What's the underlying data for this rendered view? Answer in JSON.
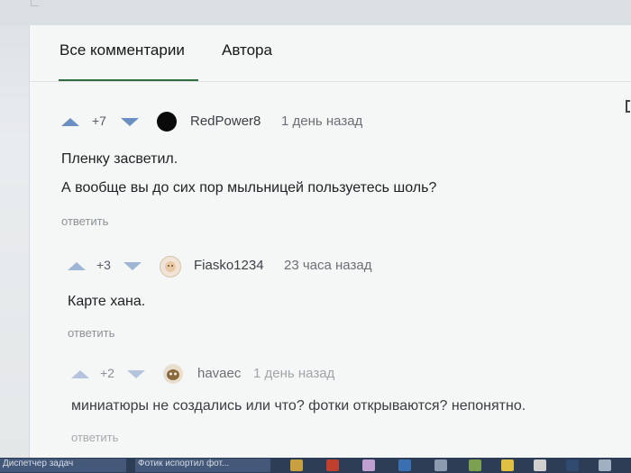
{
  "tabs": {
    "all_comments": "Все комментарии",
    "author": "Автора"
  },
  "comments": [
    {
      "rating": "+7",
      "username": "RedPower8",
      "time": "1 день назад",
      "lines": [
        "Пленку засветил.",
        "А вообще вы до сих пор мыльницей пользуетесь шоль?"
      ],
      "reply_label": "ответить",
      "avatar_icon": "black-circle-avatar"
    },
    {
      "rating": "+3",
      "username": "Fiasko1234",
      "time": "23 часа назад",
      "lines": [
        "Карте хана."
      ],
      "reply_label": "ответить",
      "avatar_icon": "face-avatar"
    },
    {
      "rating": "+2",
      "username": "havaec",
      "time": "1 день назад",
      "lines": [
        "миниатюры не создались или что? фотки открываются? непонятно."
      ],
      "reply_label": "ответить",
      "avatar_icon": "cartoon-avatar"
    }
  ],
  "taskbar": {
    "items": [
      "Диспетчер задач",
      "Фотик испортил фот..."
    ]
  },
  "colors": {
    "vote_arrow": "#6b8fc2",
    "tab_underline": "#2f6f3f",
    "reply_text": "#8c9297",
    "taskbar": "#2d3d55"
  }
}
